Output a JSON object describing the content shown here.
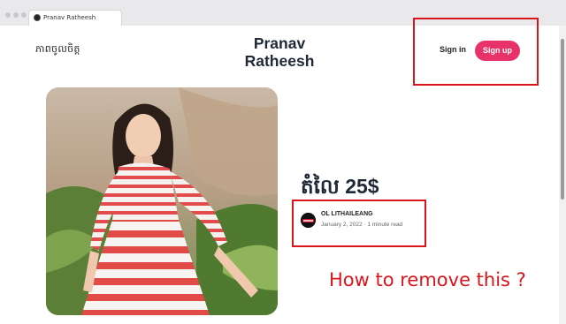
{
  "browser": {
    "tab_title": "Pranav Ratheesh"
  },
  "header": {
    "nav_label": "ភាពចូលចិត្ត",
    "site_title_line1": "Pranav",
    "site_title_line2": "Ratheesh",
    "sign_in_label": "Sign in",
    "sign_up_label": "Sign up"
  },
  "post": {
    "title": "តំលៃ 25$",
    "author": "OL LITHAILEANG",
    "date": "January 2, 2022",
    "separator": "·",
    "read_time": "1 minute read"
  },
  "annotation": {
    "text": "How to remove this ?",
    "color": "#d8161c"
  },
  "colors": {
    "accent": "#e8336a",
    "heading": "#1f2937"
  }
}
